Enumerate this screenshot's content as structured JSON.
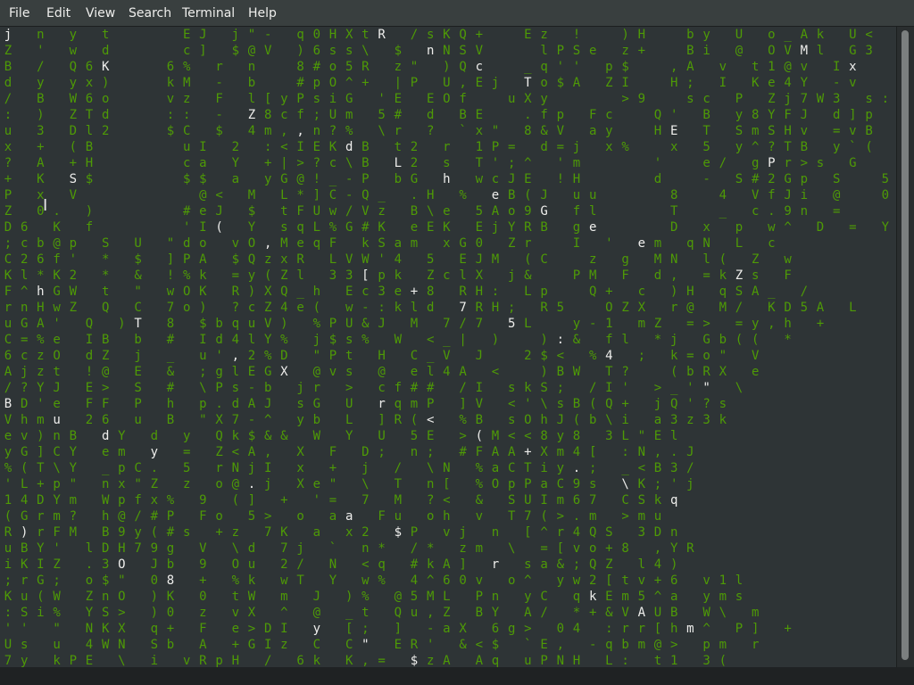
{
  "menubar": {
    "items": [
      {
        "label": "File"
      },
      {
        "label": "Edit"
      },
      {
        "label": "View"
      },
      {
        "label": "Search"
      },
      {
        "label": "Terminal"
      },
      {
        "label": "Help"
      }
    ]
  },
  "terminal": {
    "colors": {
      "background": "#2e3436",
      "rain_green": "#4e9a06",
      "highlight_white": "#eeeeec"
    },
    "lines": [
      "j  n  y  t     E J  j \" -  q 0 H X t R  / s K Q +   E z  !   ) H   b y  U  o _ A k  U <",
      "Z  '  w  d     c ]  $ @ V  ) 6 s s \\  $  n N S V    l P S e  z +   B i  @  O V M l  G 3",
      "B  /  Q 6 K    6 %  r  n   8 # o 5 R  z \"  ) Q c   _ q ' '  p $   , A  v  t 1 @ v  I x",
      "d  y  y x )    k M  -  b   # p O ^ +  | P  U , E j  T o $ A  Z I   H ;  I  K e 4 Y  - v",
      "/  B  W 6 o    v z  F  l [ y P s i G  ' E  E O f   u X y     > 9   s c  P  Z j 7 W 3  s :",
      ":  )  Z T d    : :  -  Z 8 c f ; U m  5 #  d  B E   . f p  F c   Q '  B  y 8 Y F J  d ] p",
      "u  3  D l 2    $ C  $  4 m , , n ? %  \\ r  ?  ` x \"  8 & V  a y   H E  T  S m S H v  = v B",
      "x  +  ( B      u I  2  : < I E K d B  t 2  r  1 P =  d = j  x %   x  5  y ^ ? T B  y ` (",
      "?  A  + H      c a  Y  + | > ? c \\ B  L 2  s  T ' ; ^  ' m     '   e /  g P r > s  G   7",
      "+  K  S $      $ $  a  y G @ ! _ - P  b G  h  w c J E  ! H     d   -  S # 2 G p  S   5",
      "P  x  V        @ <  M  L * ] C - Q _  . H  %  e B ( J  u u     8   4  V f J i  @   0",
      "Z  0 .  )      # e J  $  t F U w / V z  B \\ e  5 A o 9 G  f l     T   _  c . 9 n  =",
      "D 6  K  f      ' I (  Y  s q L % G # K  e E K  E j Y R B  g e     D  x  p  w ^  D  =  Y",
      "; c b @ p  S  U  \" d o  v O , M e q F  k S a m  x G 0  Z r   I  '  e m  q N  L  c",
      "C 2 6 f '  *  $  ] P A  $ Q z x R  L V W ' 4  5  E J M  ( C   z  g  M N  l (  Z  w",
      "K l * K 2  *  &  ! % k  = y ( Z l  3 3 [ p k  Z c l X  j &   P M  F  d ,  = k Z s  F",
      "F ^ h G W  t  \"  w O K  R ) X Q _ h  E c 3 e + 8  R H :  L p   Q +  c  ) H  q S A _  /",
      "r n H w Z  Q  C  7 o )  ? c Z 4 e (  w - : k l d  7 R H ;  R 5   O Z X  r @  M /  K D 5 A  L",
      "u G A '  Q  ) T  8  $ b q u V )  % P U & J  M  7 / 7  5 L   y - 1  m Z  = >  = y , h  +",
      "C = % e  I B  b  #  I d 4 l Y %  j $ s %  W  < _ |  )   ) : &  f l  * j  G b ( (  *",
      "6 c z O  d Z  j  _  u ' , 2 % D  \" P t  H  C _ V  J   2 $ <  % 4  ;  k = o \"  V",
      "A j z t  ! @  E  &  ; g l E G X  @ v s  @  e l 4 A  <   ) B W  T ?   ( b R X  e",
      "/ ? Y J  E >  S  #  \\ P s - b  j r  >  c f # #  / I  s k S ;  / I '  > _ ' \"  \\",
      "B D ' e  F F  P  h  p . d A J  s G  U  r q m P  ] V  < ' \\ s B ( Q +  j Q ' ? s",
      "V h m u  2 6  u  B  \" X 7 - ^  y b  L  ] R ( <  % B  s O h J ( b \\ i  a 3 z 3 k",
      "e v ) n B  d Y  d  y  Q k $ & &  W  Y  U  5 E  > ( M < < 8 y 8  3 L \" E l",
      "y G ] C Y  e m  y  =  Z < A ,  X  F  D ;  n ;  # F A A + X m 4 [  : N , . J",
      "% ( T \\ Y  _ p C .  5  r N j I  x  +  j  /  \\ N  % a C T i y . ;  _ < B 3 /",
      "' L + p \"  n x \" Z  z  o @ . j  X e \"  \\  T  n [  % O p P a C 9 s  \\ K ; ' j",
      "1 4 D Y m  W p f x %  9  ( ]  +  ' =  7  M  ? <  &  S U I m 6 7  C S k q",
      "( G r m ?  h @ / # P  F o  5 >  o  a a  F u  o h  v  T 7 ( > . m  > m u",
      "R ) r F M  B 9 y ( # s  + z  7 K  a  x 2  $ P  v j  n  [ ^ r 4 Q S  3 D n",
      "u B Y '  l D H 7 9 g  V  \\ d  7 j  `  n *  / *  z m  \\  = [ v o + 8  , Y R",
      "i K I Z  . 3 O  J b  9  O u  2 /  N  < q  # k A ]  r  s a & ; Q Z  l 4 )",
      "; r G ;  o $ \"  0 8  +  % k  w T  Y  w %  4 ^ 6 0 v  o ^  y w 2 [ t v + 6  v 1 l",
      "K u ( W  Z n O  ) K  0  t W  m  J  ) %  @ 5 M L  P n  y C  q k E m 5 ^ a  y m s",
      ": S i %  Y S >  ) 0  z  v X  ^  @  _ t  Q u , Z  B Y  A /  * + & V A U B  W \\  m",
      "' '  \"  N K X  q +  F  e > D I  y  [ ;  ]  - a X  6 g >  0 4  : r r [ h m ^  P ]  +",
      "U s  u  4 W N  S b  A  + G I z  C  C \"  E R '  & < $  ` E ,  - q b m @ >  p m  r",
      "7 y  k P E  \\  i  v R p H  /  6 k  K , =  $ z A  A q  u P N H  L :  t 1  3 ("
    ]
  }
}
